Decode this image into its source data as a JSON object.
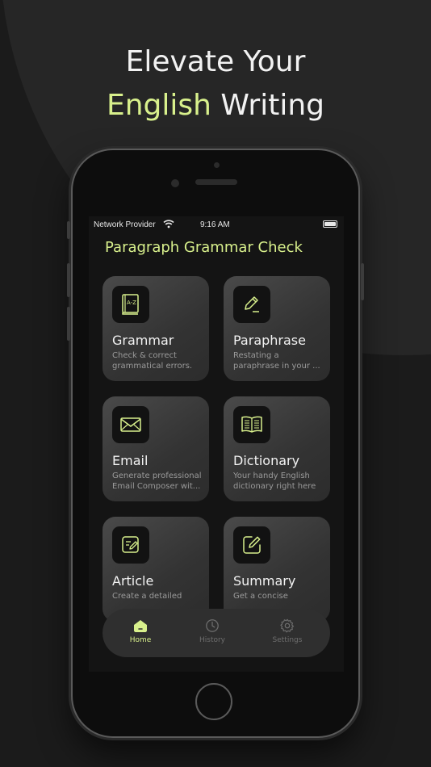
{
  "headline": {
    "line1": "Elevate Your",
    "line2_accent": "English",
    "line2_rest": " Writing"
  },
  "status_bar": {
    "carrier": "Network Provider",
    "time": "9:16 AM"
  },
  "app": {
    "title": "Paragraph Grammar Check"
  },
  "cards": [
    {
      "name": "Grammar",
      "desc_line1": "Check & correct",
      "desc_line2": "grammatical errors.",
      "icon": "az-book-icon"
    },
    {
      "name": "Paraphrase",
      "desc_line1": "Restating a",
      "desc_line2": "paraphrase in your ...",
      "icon": "pencil-icon"
    },
    {
      "name": "Email",
      "desc_line1": "Generate professional",
      "desc_line2": "Email Composer wit...",
      "icon": "envelope-icon"
    },
    {
      "name": "Dictionary",
      "desc_line1": "Your handy English",
      "desc_line2": "dictionary right here",
      "icon": "open-book-icon"
    },
    {
      "name": "Article",
      "desc_line1": "Create a detailed",
      "desc_line2": "",
      "icon": "article-edit-icon"
    },
    {
      "name": "Summary",
      "desc_line1": "Get a concise",
      "desc_line2": "",
      "icon": "summary-edit-icon"
    }
  ],
  "tabs": [
    {
      "label": "Home",
      "icon": "home-icon",
      "active": true
    },
    {
      "label": "History",
      "icon": "clock-icon",
      "active": false
    },
    {
      "label": "Settings",
      "icon": "gear-icon",
      "active": false
    }
  ],
  "colors": {
    "accent": "#d8f08c",
    "background": "#1b1b1b",
    "card": "#3a3a3a"
  }
}
